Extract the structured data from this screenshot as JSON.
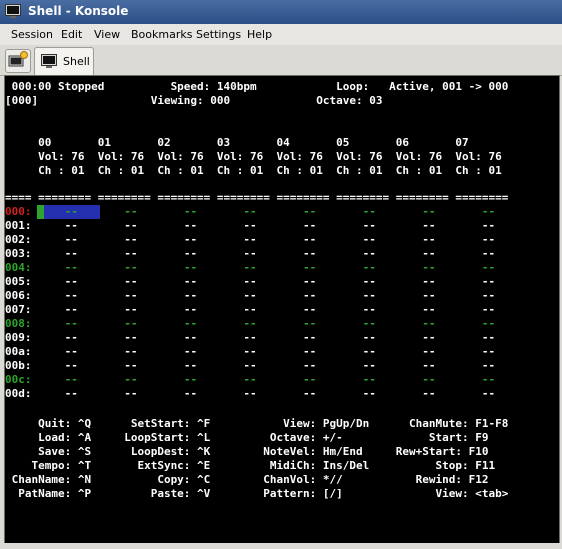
{
  "window": {
    "title": "Shell - Konsole"
  },
  "menu": [
    "Session",
    "Edit",
    "View",
    "Bookmarks",
    "Settings",
    "Help"
  ],
  "tab": {
    "label": "Shell"
  },
  "terminal": {
    "status1": " 000:00 Stopped          Speed: 140bpm            Loop:   Active, 001 -> 000",
    "status2": "[000]                 Viewing: 000             Octave: 03",
    "chan_nums": "     00       01       02       03       04       05       06       07",
    "chan_vol": "     Vol: 76  Vol: 76  Vol: 76  Vol: 76  Vol: 76  Vol: 76  Vol: 76  Vol: 76",
    "chan_ch": "     Ch : 01  Ch : 01  Ch : 01  Ch : 01  Ch : 01  Ch : 01  Ch : 01  Ch : 01",
    "separator": "==== ======== ======== ======== ======== ======== ======== ======== ========",
    "rows": [
      {
        "label": "000:",
        "cells": "     --       --       --       --       --       --       --       --",
        "color": "r"
      },
      {
        "label": "001:",
        "cells": "     --       --       --       --       --       --       --       --",
        "color": "w"
      },
      {
        "label": "002:",
        "cells": "     --       --       --       --       --       --       --       --",
        "color": "w"
      },
      {
        "label": "003:",
        "cells": "     --       --       --       --       --       --       --       --",
        "color": "w"
      },
      {
        "label": "004:",
        "cells": "     --       --       --       --       --       --       --       --",
        "color": "g"
      },
      {
        "label": "005:",
        "cells": "     --       --       --       --       --       --       --       --",
        "color": "w"
      },
      {
        "label": "006:",
        "cells": "     --       --       --       --       --       --       --       --",
        "color": "w"
      },
      {
        "label": "007:",
        "cells": "     --       --       --       --       --       --       --       --",
        "color": "w"
      },
      {
        "label": "008:",
        "cells": "     --       --       --       --       --       --       --       --",
        "color": "g"
      },
      {
        "label": "009:",
        "cells": "     --       --       --       --       --       --       --       --",
        "color": "w"
      },
      {
        "label": "00a:",
        "cells": "     --       --       --       --       --       --       --       --",
        "color": "w"
      },
      {
        "label": "00b:",
        "cells": "     --       --       --       --       --       --       --       --",
        "color": "w"
      },
      {
        "label": "00c:",
        "cells": "     --       --       --       --       --       --       --       --",
        "color": "g"
      },
      {
        "label": "00d:",
        "cells": "     --       --       --       --       --       --       --       --",
        "color": "w"
      }
    ],
    "help": [
      "     Quit: ^Q      SetStart: ^F           View: PgUp/Dn      ChanMute: F1-F8",
      "     Load: ^A     LoopStart: ^L         Octave: +/-             Start: F9",
      "     Save: ^S      LoopDest: ^K        NoteVel: Hm/End     Rew+Start: F10",
      "    Tempo: ^T       ExtSync: ^E         MidiCh: Ins/Del          Stop: F11",
      " ChanName: ^N          Copy: ^C        ChanVol: *//           Rewind: F12",
      "  PatName: ^P         Paste: ^V        Pattern: [/]              View: <tab>"
    ]
  }
}
